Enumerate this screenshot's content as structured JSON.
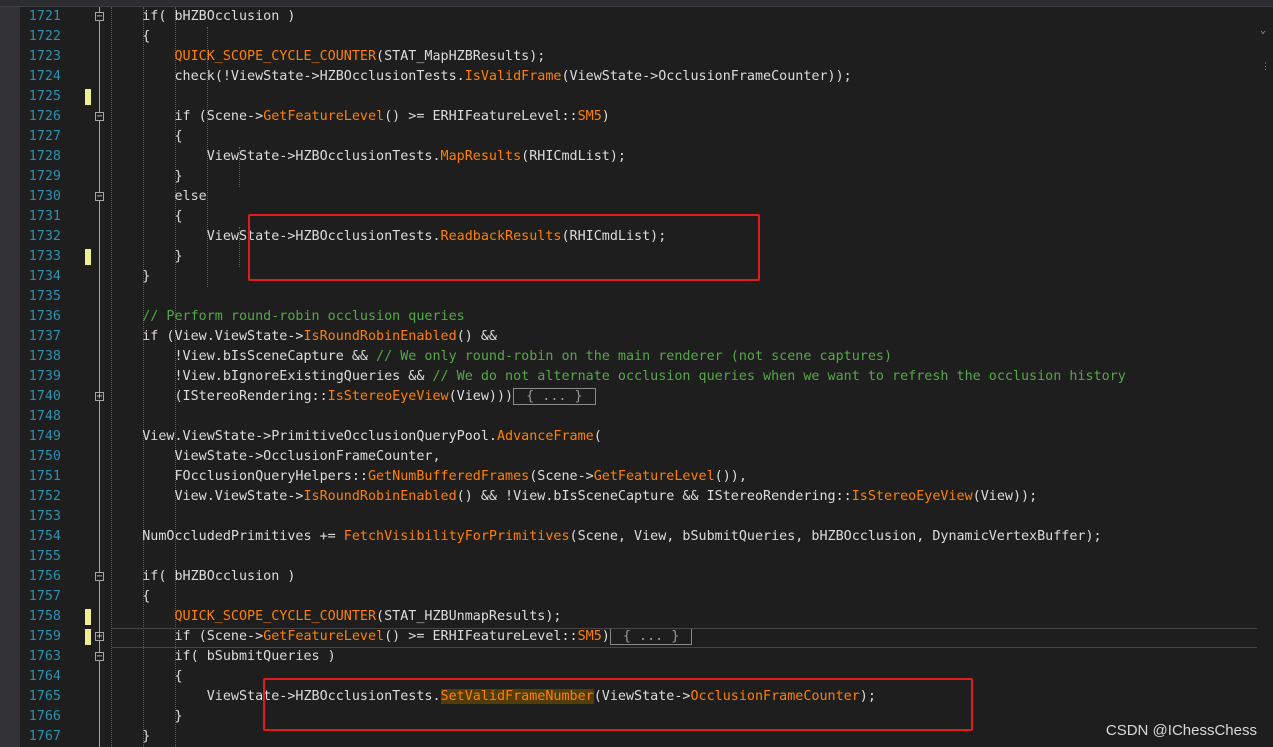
{
  "colors": {
    "keyword": "#569cd6",
    "macro": "#beb7ff",
    "function": "#ff8000",
    "comment": "#57a64a",
    "text": "#dcdcdc",
    "line_number": "#2b91af",
    "highlight": "#523c0a",
    "callout": "#e21b1b"
  },
  "watermark": "CSDN @IChessChess",
  "code_lines": [
    {
      "num": "1721",
      "fold": "minus",
      "changed": false,
      "tokens": [
        [
          "    if( bHZBOcclusion )",
          "t"
        ]
      ]
    },
    {
      "num": "1722",
      "fold": "",
      "changed": false,
      "tokens": [
        [
          "    {",
          "t"
        ]
      ]
    },
    {
      "num": "1723",
      "fold": "",
      "changed": false,
      "tokens": [
        [
          "        ",
          "t"
        ],
        [
          "QUICK_SCOPE_CYCLE_COUNTER",
          "f"
        ],
        [
          "(STAT_MapHZBResults);",
          "t"
        ]
      ]
    },
    {
      "num": "1724",
      "fold": "",
      "changed": false,
      "tokens": [
        [
          "        check",
          "t"
        ],
        [
          "(!ViewState->HZBOcclusionTests.",
          "t"
        ],
        [
          "IsValidFrame",
          "f"
        ],
        [
          "(ViewState->OcclusionFrameCounter));",
          "t"
        ]
      ]
    },
    {
      "num": "1725",
      "fold": "",
      "changed": true,
      "tokens": []
    },
    {
      "num": "1726",
      "fold": "minus",
      "changed": false,
      "tokens": [
        [
          "        if",
          "t"
        ],
        [
          " (Scene->",
          "t"
        ],
        [
          "GetFeatureLevel",
          "f"
        ],
        [
          "() >= ERHIFeatureLevel::",
          "t"
        ],
        [
          "SM5",
          "f"
        ],
        [
          ")",
          "t"
        ]
      ]
    },
    {
      "num": "1727",
      "fold": "",
      "changed": false,
      "tokens": [
        [
          "        {",
          "t"
        ]
      ]
    },
    {
      "num": "1728",
      "fold": "",
      "changed": false,
      "tokens": [
        [
          "            ViewState->HZBOcclusionTests.",
          "t"
        ],
        [
          "MapResults",
          "f"
        ],
        [
          "(RHICmdList);",
          "t"
        ]
      ]
    },
    {
      "num": "1729",
      "fold": "",
      "changed": false,
      "tokens": [
        [
          "        }",
          "t"
        ]
      ]
    },
    {
      "num": "1730",
      "fold": "minus",
      "changed": false,
      "tokens": [
        [
          "        else",
          "t"
        ]
      ]
    },
    {
      "num": "1731",
      "fold": "",
      "changed": false,
      "tokens": [
        [
          "        {",
          "t"
        ]
      ]
    },
    {
      "num": "1732",
      "fold": "",
      "changed": false,
      "tokens": [
        [
          "            ViewState->HZBOcclusionTests.",
          "t"
        ],
        [
          "ReadbackResults",
          "f"
        ],
        [
          "(RHICmdList);",
          "t"
        ]
      ]
    },
    {
      "num": "1733",
      "fold": "",
      "changed": true,
      "tokens": [
        [
          "        }",
          "t"
        ]
      ]
    },
    {
      "num": "1734",
      "fold": "",
      "changed": false,
      "tokens": [
        [
          "    }",
          "t"
        ]
      ]
    },
    {
      "num": "1735",
      "fold": "",
      "changed": false,
      "tokens": []
    },
    {
      "num": "1736",
      "fold": "",
      "changed": false,
      "tokens": [
        [
          "    // Perform round-robin occlusion queries",
          "c"
        ]
      ]
    },
    {
      "num": "1737",
      "fold": "",
      "changed": false,
      "tokens": [
        [
          "    if",
          "t"
        ],
        [
          " (View.ViewState->",
          "t"
        ],
        [
          "IsRoundRobinEnabled",
          "f"
        ],
        [
          "() &&",
          "t"
        ]
      ]
    },
    {
      "num": "1738",
      "fold": "",
      "changed": false,
      "tokens": [
        [
          "        !View.bIsSceneCapture && ",
          "t"
        ],
        [
          "// We only round-robin on the main renderer (not scene captures)",
          "c"
        ]
      ]
    },
    {
      "num": "1739",
      "fold": "",
      "changed": false,
      "tokens": [
        [
          "        !View.bIgnoreExistingQueries && ",
          "t"
        ],
        [
          "// We do not alternate occlusion queries when we want to refresh the occlusion history",
          "c"
        ]
      ]
    },
    {
      "num": "1740",
      "fold": "plus",
      "changed": false,
      "tokens": [
        [
          "        (IStereoRendering::",
          "t"
        ],
        [
          "IsStereoEyeView",
          "f"
        ],
        [
          "(View)))",
          "t"
        ],
        [
          " { ... } ",
          "x"
        ]
      ]
    },
    {
      "num": "1748",
      "fold": "",
      "changed": false,
      "tokens": []
    },
    {
      "num": "1749",
      "fold": "",
      "changed": false,
      "tokens": [
        [
          "    View.ViewState->PrimitiveOcclusionQueryPool.",
          "t"
        ],
        [
          "AdvanceFrame",
          "f"
        ],
        [
          "(",
          "t"
        ]
      ]
    },
    {
      "num": "1750",
      "fold": "",
      "changed": false,
      "tokens": [
        [
          "        ViewState->OcclusionFrameCounter,",
          "t"
        ]
      ]
    },
    {
      "num": "1751",
      "fold": "",
      "changed": false,
      "tokens": [
        [
          "        FOcclusionQueryHelpers::",
          "t"
        ],
        [
          "GetNumBufferedFrames",
          "f"
        ],
        [
          "(Scene->",
          "t"
        ],
        [
          "GetFeatureLevel",
          "f"
        ],
        [
          "()),",
          "t"
        ]
      ]
    },
    {
      "num": "1752",
      "fold": "",
      "changed": false,
      "tokens": [
        [
          "        View.ViewState->",
          "t"
        ],
        [
          "IsRoundRobinEnabled",
          "f"
        ],
        [
          "() && !View.bIsSceneCapture && IStereoRendering::",
          "t"
        ],
        [
          "IsStereoEyeView",
          "f"
        ],
        [
          "(View));",
          "t"
        ]
      ]
    },
    {
      "num": "1753",
      "fold": "",
      "changed": false,
      "tokens": []
    },
    {
      "num": "1754",
      "fold": "",
      "changed": false,
      "tokens": [
        [
          "    NumOccludedPrimitives += ",
          "t"
        ],
        [
          "FetchVisibilityForPrimitives",
          "f"
        ],
        [
          "(Scene, View, bSubmitQueries, bHZBOcclusion, DynamicVertexBuffer);",
          "t"
        ]
      ]
    },
    {
      "num": "1755",
      "fold": "",
      "changed": false,
      "tokens": []
    },
    {
      "num": "1756",
      "fold": "minus",
      "changed": false,
      "tokens": [
        [
          "    if( bHZBOcclusion )",
          "t"
        ]
      ]
    },
    {
      "num": "1757",
      "fold": "",
      "changed": false,
      "tokens": [
        [
          "    {",
          "t"
        ]
      ]
    },
    {
      "num": "1758",
      "fold": "",
      "changed": true,
      "tokens": [
        [
          "        ",
          "t"
        ],
        [
          "QUICK_SCOPE_CYCLE_COUNTER",
          "f"
        ],
        [
          "(STAT_HZBUnmapResults);",
          "t"
        ]
      ]
    },
    {
      "num": "1759",
      "fold": "plus",
      "changed": true,
      "tokens": [
        [
          "        if",
          "t"
        ],
        [
          " (Scene->",
          "t"
        ],
        [
          "GetFeatureLevel",
          "f"
        ],
        [
          "() >= ERHIFeatureLevel::",
          "t"
        ],
        [
          "SM5",
          "f"
        ],
        [
          ")",
          "t"
        ],
        [
          " { ... } ",
          "x"
        ]
      ]
    },
    {
      "num": "1763",
      "fold": "minus",
      "changed": false,
      "tokens": [
        [
          "        if( bSubmitQueries )",
          "t"
        ]
      ]
    },
    {
      "num": "1764",
      "fold": "",
      "changed": false,
      "tokens": [
        [
          "        {",
          "t"
        ]
      ]
    },
    {
      "num": "1765",
      "fold": "",
      "changed": false,
      "tokens": [
        [
          "            ViewState->HZBOcclusionTests.",
          "t"
        ],
        [
          "SetValidFrameNumber",
          "h"
        ],
        [
          "(ViewState->",
          "t"
        ],
        [
          "OcclusionFrameCounter",
          "f"
        ],
        [
          ");",
          "t"
        ]
      ]
    },
    {
      "num": "1766",
      "fold": "",
      "changed": false,
      "tokens": [
        [
          "        }",
          "t"
        ]
      ]
    },
    {
      "num": "1767",
      "fold": "",
      "changed": false,
      "tokens": [
        [
          "    }",
          "t"
        ]
      ]
    }
  ]
}
